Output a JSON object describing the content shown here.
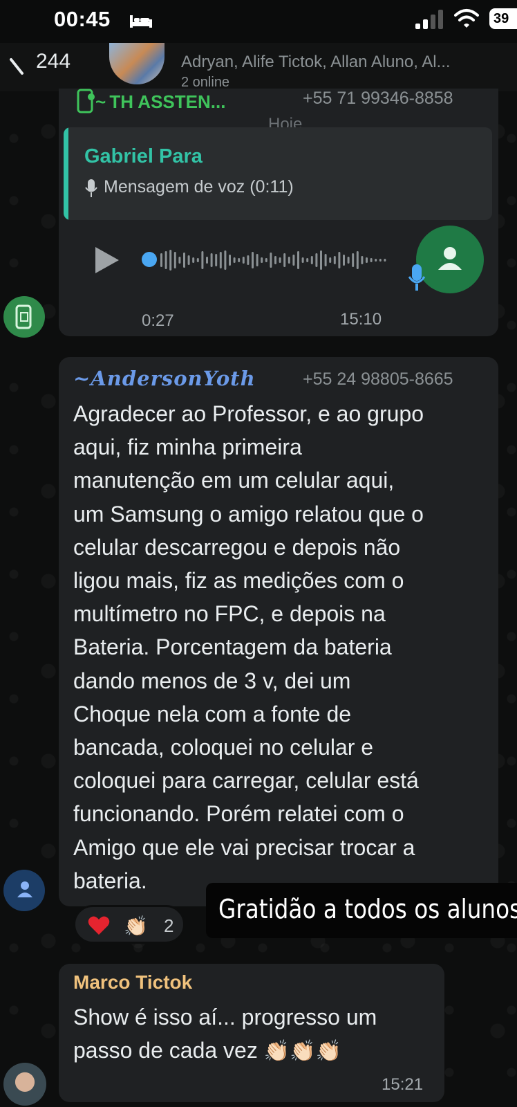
{
  "status_bar": {
    "time": "00:45",
    "battery": "39"
  },
  "header": {
    "back_count": "244",
    "members": "Adryan, Alife Tictok, Allan Aluno, Al...",
    "subtitle": "2 online"
  },
  "voice_message": {
    "sender": "~ TH ASSTEN...",
    "phone": "+55 71 99346-8858",
    "date_separator": "Hoje",
    "quoted_name": "Gabriel Para",
    "quoted_text": "Mensagem de voz (0:11)",
    "duration": "0:27",
    "time": "15:10"
  },
  "message2": {
    "sender": "~AndersonYoth",
    "phone": "+55 24 98805-8665",
    "lines": [
      "Agradecer ao Professor, e ao grupo",
      "aqui, fiz minha primeira",
      "manutenção em um celular aqui,",
      "um Samsung o amigo relatou que o",
      "celular descarregou e depois não",
      "ligou mais, fiz as medições com o",
      "multímetro no FPC, e depois na",
      "Bateria. Porcentagem da bateria",
      "dando menos de 3 v, dei um",
      "Choque nela com a fonte de",
      "bancada, coloquei no celular e",
      "coloquei para carregar, celular está",
      "funcionando. Porém relatei com o",
      "Amigo que ele vai precisar trocar a",
      "bateria."
    ],
    "reactions": {
      "heart": "❤️",
      "clap": "👏🏻",
      "count": "2"
    }
  },
  "caption": "Gratidão a todos os alunos",
  "message3": {
    "sender": "Marco Tictok",
    "line1": "Show é isso aí... progresso um",
    "line2": "passo de cada vez",
    "emojis": "👏🏻👏🏻👏🏻",
    "time": "15:21"
  },
  "colors": {
    "sender1": "#3fc45b",
    "sender2": "#6b9ae8",
    "sender3": "#f0c27d",
    "quote_accent": "#32c3a6",
    "bubble": "#1f2123",
    "voice_avatar": "#1f7a45"
  }
}
